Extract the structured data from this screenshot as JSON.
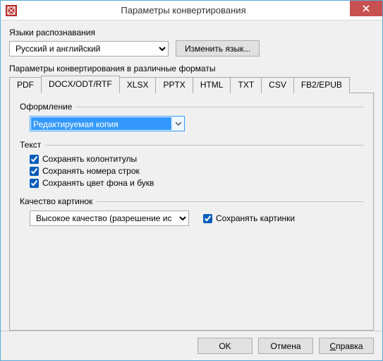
{
  "window": {
    "title": "Параметры конвертирования"
  },
  "lang": {
    "label": "Языки распознавания",
    "selected": "Русский и английский",
    "change_btn": "Изменить язык..."
  },
  "formats": {
    "label": "Параметры конвертирования в различные форматы",
    "tabs": [
      "PDF",
      "DOCX/ODT/RTF",
      "XLSX",
      "PPTX",
      "HTML",
      "TXT",
      "CSV",
      "FB2/EPUB"
    ],
    "active_index": 1
  },
  "layout": {
    "legend": "Оформление",
    "selected": "Редактируемая копия"
  },
  "text": {
    "legend": "Текст",
    "keep_headers": "Сохранять колонтитулы",
    "keep_line_numbers": "Сохранять номера строк",
    "keep_colors": "Сохранять цвет фона и букв"
  },
  "quality": {
    "legend": "Качество картинок",
    "selected": "Высокое качество (разрешение ис",
    "keep_pictures": "Сохранять картинки"
  },
  "buttons": {
    "ok": "OK",
    "cancel": "Отмена",
    "help": "Справка"
  }
}
